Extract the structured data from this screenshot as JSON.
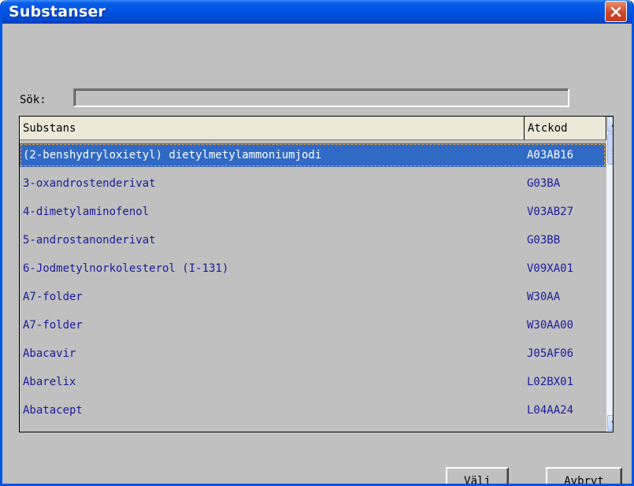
{
  "window": {
    "title": "Substanser"
  },
  "search": {
    "label": "Sök:",
    "value": "",
    "placeholder": ""
  },
  "columns": {
    "substans": "Substans",
    "atckod": "Atckod"
  },
  "rows": [
    {
      "substans": "(2-benshydryloxietyl) dietylmetylammoniumjodi",
      "atckod": "A03AB16",
      "selected": true
    },
    {
      "substans": "3-oxandrostenderivat",
      "atckod": "G03BA"
    },
    {
      "substans": "4-dimetylaminofenol",
      "atckod": "V03AB27"
    },
    {
      "substans": "5-androstanonderivat",
      "atckod": "G03BB"
    },
    {
      "substans": "6-Jodmetylnorkolesterol (I-131)",
      "atckod": "V09XA01"
    },
    {
      "substans": "A7-folder",
      "atckod": "W30AA"
    },
    {
      "substans": "A7-folder",
      "atckod": "W30AA00"
    },
    {
      "substans": "Abacavir",
      "atckod": "J05AF06"
    },
    {
      "substans": "Abarelix",
      "atckod": "L02BX01"
    },
    {
      "substans": "Abatacept",
      "atckod": "L04AA24"
    }
  ],
  "buttons": {
    "valj": {
      "mnemonic": "V",
      "rest": "älj"
    },
    "avbryt": {
      "mnemonic": "A",
      "rest": "vbryt"
    }
  },
  "icons": {
    "close": "close-icon",
    "scroll_up": "arrow-up-icon",
    "scroll_down": "arrow-down-icon"
  },
  "colors": {
    "titlebar": "#0053e1",
    "selection": "#316ac5",
    "row_text": "#1a1a9a",
    "close": "#d1472a"
  }
}
